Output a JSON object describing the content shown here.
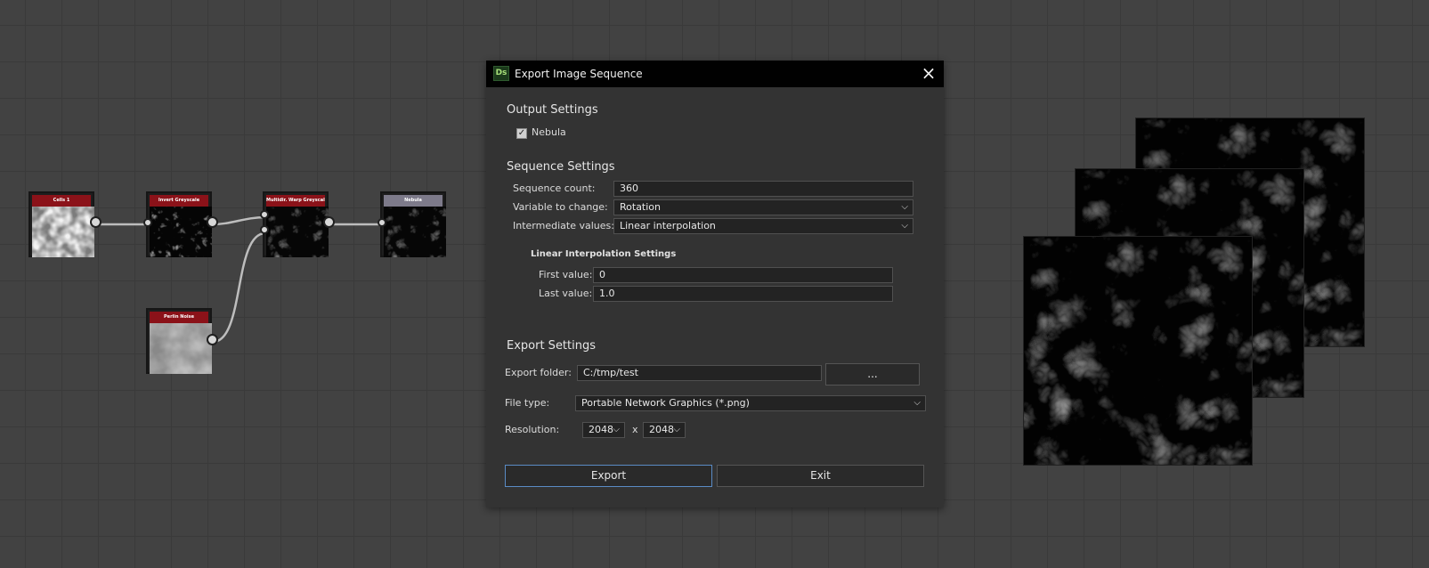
{
  "graph": {
    "nodes": [
      {
        "id": "cells",
        "title": "Cells 1",
        "header": "red",
        "texture": "cells"
      },
      {
        "id": "invert",
        "title": "Invert Greyscale",
        "header": "red",
        "texture": "inverted-cells"
      },
      {
        "id": "warp",
        "title": "Multidir. Warp Greyscale",
        "header": "red",
        "texture": "warp"
      },
      {
        "id": "nebula",
        "title": "Nebula",
        "header": "gray",
        "texture": "warp"
      },
      {
        "id": "perlin",
        "title": "Perlin Noise",
        "header": "red",
        "texture": "perlin"
      }
    ]
  },
  "dialog": {
    "title": "Export Image Sequence",
    "app_icon": "Ds",
    "close_icon": "close-icon",
    "output": {
      "heading": "Output Settings",
      "checkbox_label": "Nebula",
      "checked": true
    },
    "sequence": {
      "heading": "Sequence Settings",
      "count_label": "Sequence count:",
      "count_value": "360",
      "variable_label": "Variable to change:",
      "variable_value": "Rotation",
      "intermediate_label": "Intermediate values:",
      "intermediate_value": "Linear interpolation"
    },
    "linear": {
      "heading": "Linear Interpolation Settings",
      "first_label": "First value:",
      "first_value": "0",
      "last_label": "Last value:",
      "last_value": "1.0"
    },
    "export": {
      "heading": "Export Settings",
      "folder_label": "Export folder:",
      "folder_value": "C:/tmp/test",
      "browse_label": "...",
      "filetype_label": "File type:",
      "filetype_value": "Portable Network Graphics (*.png)",
      "resolution_label": "Resolution:",
      "res_width": "2048",
      "res_sep": "x",
      "res_height": "2048"
    },
    "buttons": {
      "export": "Export",
      "exit": "Exit"
    }
  }
}
